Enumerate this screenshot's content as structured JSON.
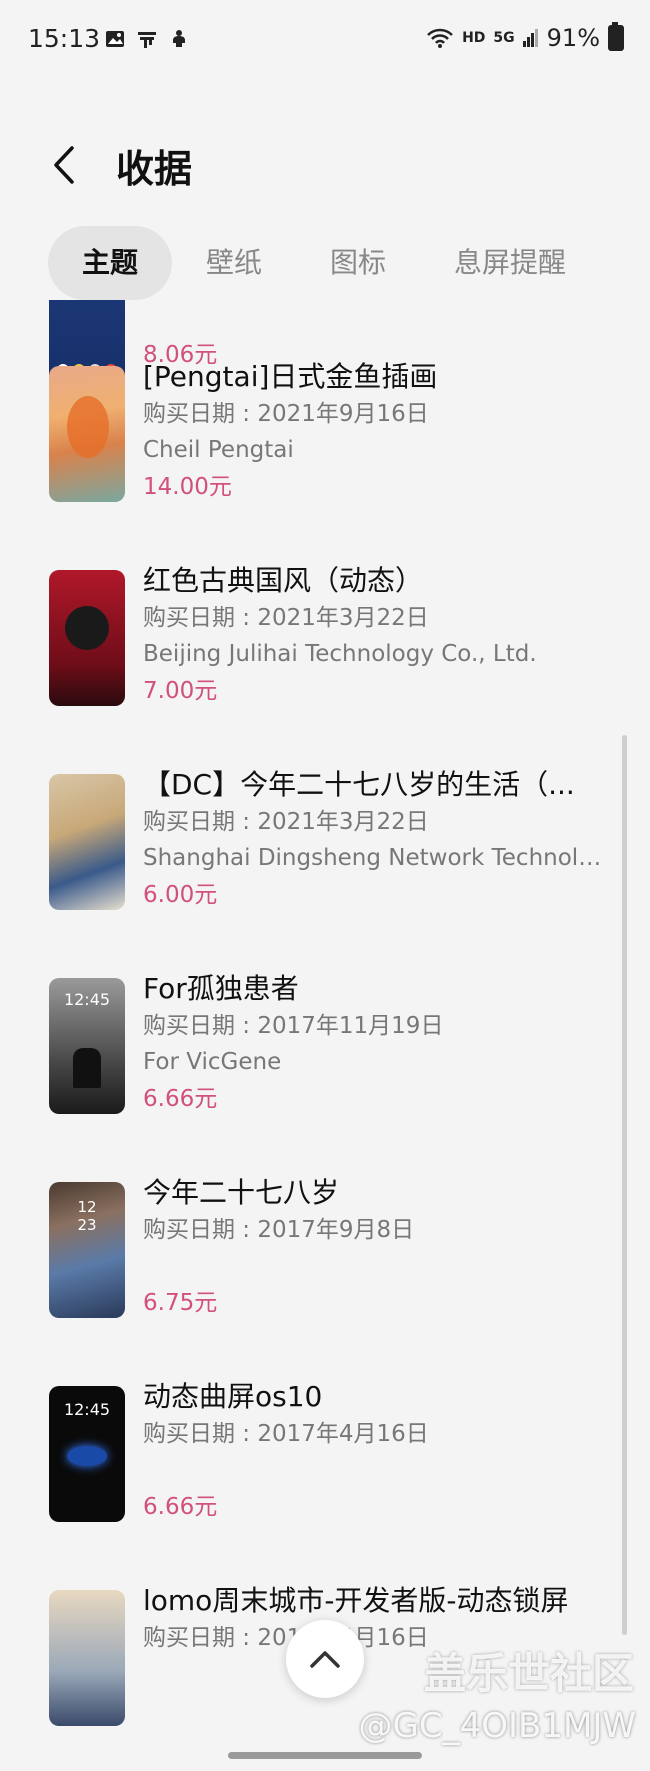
{
  "status_bar": {
    "time": "15:13",
    "network": "HD",
    "signal": "5G",
    "battery": "91%"
  },
  "header": {
    "title": "收据"
  },
  "tabs": [
    {
      "label": "主题",
      "active": true
    },
    {
      "label": "壁纸",
      "active": false
    },
    {
      "label": "图标",
      "active": false
    },
    {
      "label": "息屏提醒",
      "active": false
    }
  ],
  "items": [
    {
      "name": "",
      "date": "",
      "vendor": "",
      "price": "8.06元"
    },
    {
      "name": "[Pengtai]日式金鱼插画",
      "date": "购买日期 : 2021年9月16日",
      "vendor": "Cheil Pengtai",
      "price": "14.00元"
    },
    {
      "name": "红色古典国风（动态）",
      "date": "购买日期 : 2021年3月22日",
      "vendor": "Beijing Julihai Technology Co., Ltd.",
      "price": "7.00元"
    },
    {
      "name": "【DC】今年二十七八岁的生活（...",
      "date": "购买日期 : 2021年3月22日",
      "vendor": "Shanghai Dingsheng Network Technolo...",
      "price": "6.00元"
    },
    {
      "name": "For孤独患者",
      "date": "购买日期 : 2017年11月19日",
      "vendor": "For VicGene",
      "price": "6.66元"
    },
    {
      "name": "今年二十七八岁",
      "date": "购买日期 : 2017年9月8日",
      "vendor": "",
      "price": "6.75元"
    },
    {
      "name": "动态曲屏os10",
      "date": "购买日期 : 2017年4月16日",
      "vendor": "",
      "price": "6.66元"
    },
    {
      "name": "lomo周末城市-开发者版-动态锁屏",
      "date": "购买日期 : 2017年4月16日",
      "vendor": "",
      "price": ""
    }
  ],
  "watermark": {
    "brand": "盖乐世社区",
    "id": "@GC_4OIB1MJW"
  },
  "colors": {
    "price": "#d2507d",
    "background": "#f4f4f4"
  },
  "icons": [
    "gallery-icon",
    "notification-icon",
    "accessibility-icon",
    "wifi-icon",
    "signal-icon",
    "battery-icon",
    "back-arrow-icon",
    "chevron-up-icon"
  ]
}
